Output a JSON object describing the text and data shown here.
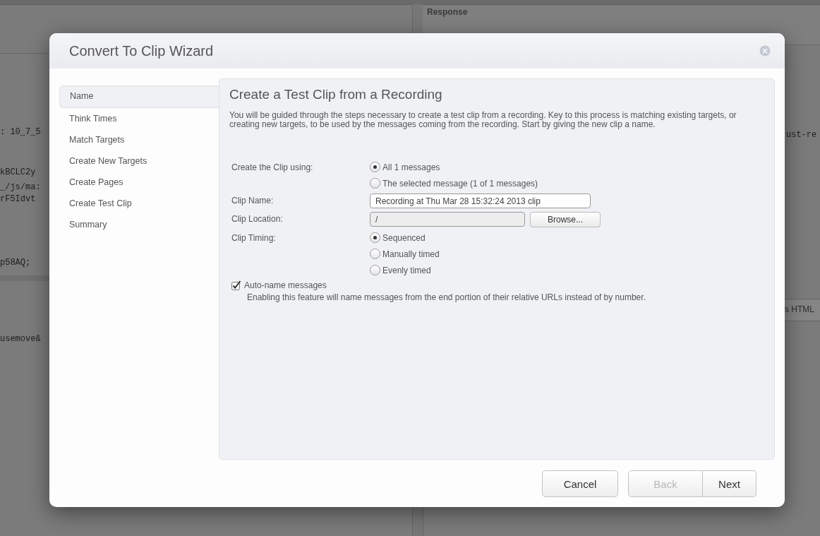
{
  "background": {
    "panel_title": "Response",
    "left_code_lines": [
      ": 10_7_5",
      "kBCLC2y",
      "_/js/ma:",
      "rF5Idvt",
      "p58AQ; ",
      "usemove&"
    ],
    "right_code_lines": [
      "ust-re"
    ],
    "tab_label": "s HTML"
  },
  "dialog": {
    "title": "Convert To Clip Wizard",
    "steps": [
      {
        "label": "Name",
        "selected": true
      },
      {
        "label": "Think Times",
        "selected": false
      },
      {
        "label": "Match Targets",
        "selected": false
      },
      {
        "label": "Create New Targets",
        "selected": false
      },
      {
        "label": "Create Pages",
        "selected": false
      },
      {
        "label": "Create Test Clip",
        "selected": false
      },
      {
        "label": "Summary",
        "selected": false
      }
    ],
    "heading": "Create a Test Clip from a Recording",
    "description": "You will be guided through the steps necessary to create a test clip from a recording. Key to this process is matching existing targets, or creating new targets, to be used by the messages coming from the recording. Start by giving the new clip a name.",
    "clip_source": {
      "label": "Create the Clip using:",
      "options": [
        {
          "label": "All 1 messages",
          "selected": true
        },
        {
          "label": "The selected message (1 of 1 messages)",
          "selected": false
        }
      ]
    },
    "clip_name": {
      "label": "Clip Name:",
      "value": "Recording at Thu Mar 28 15:32:24 2013 clip"
    },
    "clip_location": {
      "label": "Clip Location:",
      "value": "/",
      "button": "Browse..."
    },
    "clip_timing": {
      "label": "Clip Timing:",
      "options": [
        {
          "label": "Sequenced",
          "selected": true
        },
        {
          "label": "Manually timed",
          "selected": false
        },
        {
          "label": "Evenly timed",
          "selected": false
        }
      ]
    },
    "auto_name": {
      "label": "Auto-name messages",
      "checked": true,
      "description": "Enabling this feature will name messages from the end portion of their relative URLs instead of by number."
    },
    "buttons": [
      {
        "label": "Cancel",
        "disabled": false
      },
      {
        "label": "Back",
        "disabled": true
      },
      {
        "label": "Next",
        "disabled": false
      }
    ]
  }
}
